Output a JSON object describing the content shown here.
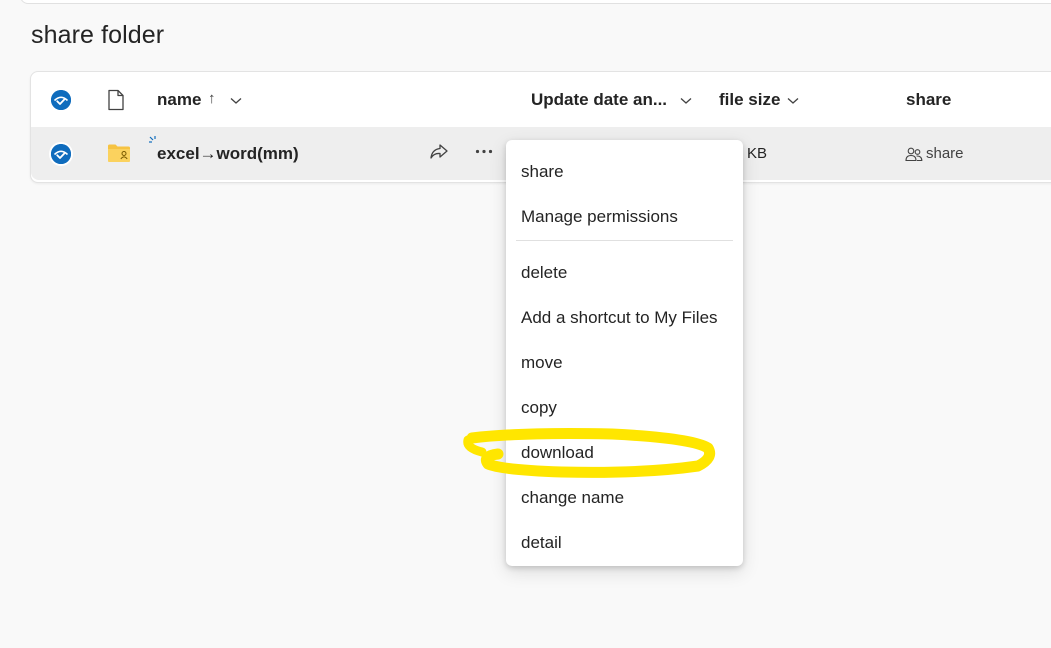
{
  "page": {
    "title": "share folder"
  },
  "list": {
    "columns": {
      "name": "name",
      "sort_indicator": "↑",
      "update_date": "Update date an...",
      "file_size": "file size",
      "share": "share"
    },
    "rows": [
      {
        "name": "excel→word(mm)",
        "size": "KB",
        "share": "share"
      }
    ]
  },
  "context_menu": {
    "items": [
      {
        "label": "share"
      },
      {
        "label": "Manage permissions"
      },
      {
        "label": "delete"
      },
      {
        "label": "Add a shortcut to My Files"
      },
      {
        "label": "move"
      },
      {
        "label": "copy"
      },
      {
        "label": "download"
      },
      {
        "label": "change name"
      },
      {
        "label": "detail"
      }
    ]
  },
  "colors": {
    "accent": "#0f6cbd",
    "folder": "#f6c342",
    "highlight": "#ffe600"
  },
  "icons": {
    "select_all": "check-circle-icon",
    "file_type": "document-icon",
    "folder": "shared-folder-icon",
    "share_action": "share-arrow-icon",
    "more": "more-dots-icon",
    "shared_people": "people-icon"
  }
}
